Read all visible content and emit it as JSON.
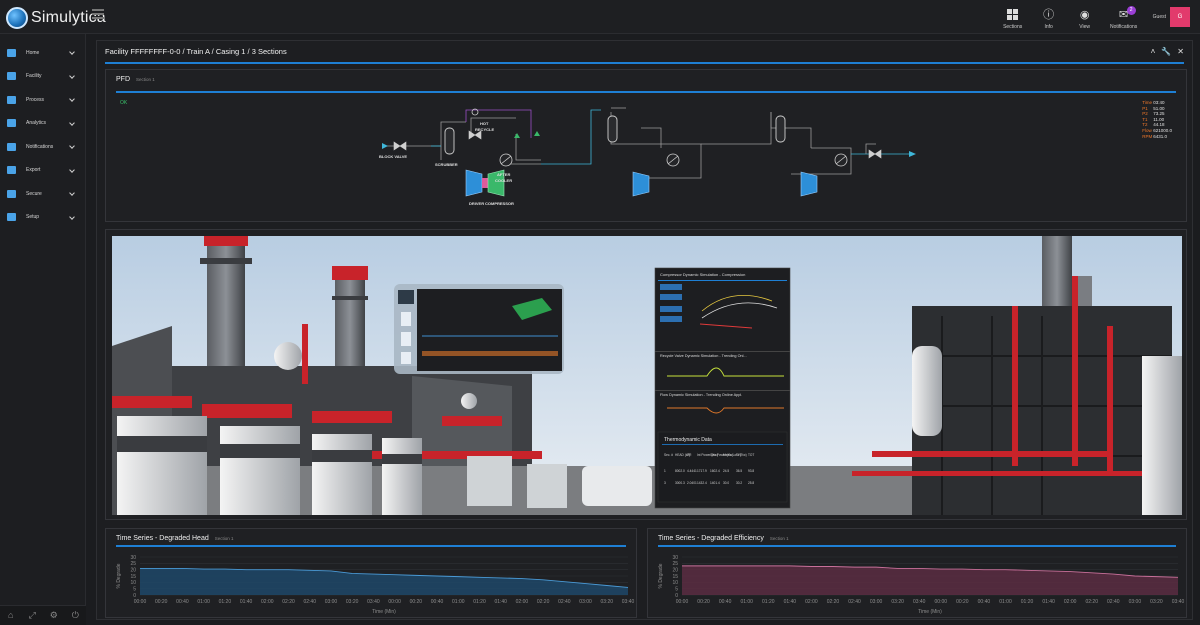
{
  "app": {
    "name": "Simulytica"
  },
  "topbar": {
    "actions": [
      {
        "id": "sections",
        "label": "Sections"
      },
      {
        "id": "info",
        "label": "Info"
      },
      {
        "id": "view",
        "label": "View"
      },
      {
        "id": "notifications",
        "label": "Notifications",
        "badge": "2"
      }
    ],
    "user": {
      "name": "Guest",
      "initial": "G"
    }
  },
  "sidebar": {
    "items": [
      {
        "label": "Home",
        "icon": "home-icon"
      },
      {
        "label": "Facility",
        "icon": "facility-icon"
      },
      {
        "label": "Process",
        "icon": "process-icon"
      },
      {
        "label": "Analytics",
        "icon": "analytics-icon"
      },
      {
        "label": "Notifications",
        "icon": "envelope-icon"
      },
      {
        "label": "Export",
        "icon": "export-icon"
      },
      {
        "label": "Secure",
        "icon": "lock-icon"
      },
      {
        "label": "Setup",
        "icon": "gear-icon"
      }
    ]
  },
  "facility": {
    "title": "Facility FFFFFFFF-0-0 / Train A / Casing 1 / 3 Sections"
  },
  "pfd": {
    "title": "PFD",
    "section": "Section 1",
    "status": "OK",
    "labels": {
      "block_valve": "BLOCK VALVE",
      "scrubber": "SCRUBBER",
      "hot_recycle_1": "HOT",
      "hot_recycle_2": "RECYCLE",
      "after_cooler_1": "AFTER",
      "after_cooler_2": "COOLER",
      "driver": "DRIVER",
      "compressor": "COMPRESSOR"
    },
    "readout": [
      {
        "k": "Time",
        "v": "03:40"
      },
      {
        "k": "P1",
        "v": "51.00"
      },
      {
        "k": "P2",
        "v": "73.25"
      },
      {
        "k": "T1",
        "v": "11.00"
      },
      {
        "k": "T2",
        "v": "44.18"
      },
      {
        "k": "Flow",
        "v": "621000.0"
      },
      {
        "k": "RPM",
        "v": "6431.0"
      }
    ]
  },
  "scene": {
    "popup_panels": [
      {
        "title": "Compressor Dynamic Simulation - Compression"
      },
      {
        "title": "Recycle Valve Dynamic Simulation - Trending Onl..."
      },
      {
        "title": "Flow Dynamic Simulation - Trending Online Appl."
      }
    ],
    "thermo": {
      "title": "Thermodynamic Data",
      "headers": [
        "Sec. #",
        "HEAD (kJ)",
        "PR",
        "Int Power (Kw)",
        "Gas Power (Kw)",
        "Mech. Loss (Kw)",
        "T?T",
        "TOT"
      ],
      "rows": [
        [
          "1",
          "8002.0",
          "4.4441",
          "1717.9",
          "1602.4",
          "24.5",
          "36.5",
          "93.8"
        ],
        [
          "3",
          "3000.3",
          "2.0401",
          "1432.4",
          "1401.4",
          "30.0",
          "30.2",
          "25.8"
        ]
      ]
    }
  },
  "chart_data": [
    {
      "type": "area",
      "title": "Time Series - Degraded Head",
      "section": "Section 1",
      "xlabel": "Time (Min)",
      "ylabel": "% Degrade",
      "ylim": [
        0,
        30
      ],
      "yticks": [
        0,
        5,
        10,
        15,
        20,
        25,
        30
      ],
      "x": [
        "00:00",
        "00:20",
        "00:40",
        "01:00",
        "01:20",
        "01:40",
        "02:00",
        "02:20",
        "02:40",
        "03:00",
        "03:20",
        "03:40",
        "00:00",
        "00:20",
        "00:40",
        "01:00",
        "01:20",
        "01:40",
        "02:00",
        "02:20",
        "02:40",
        "03:00",
        "03:20",
        "03:40"
      ],
      "values": [
        21,
        21,
        21,
        20.5,
        20.5,
        20,
        20,
        20,
        19.5,
        19,
        17,
        16.5,
        16,
        15.5,
        15,
        14.5,
        14,
        13.5,
        13,
        12,
        10.5,
        9,
        7.5,
        6
      ],
      "color": "#4a9ad6",
      "fill": "#1f4868"
    },
    {
      "type": "area",
      "title": "Time Series - Degraded Efficiency",
      "section": "Section 1",
      "xlabel": "Time (Min)",
      "ylabel": "% Degrade",
      "ylim": [
        0,
        30
      ],
      "yticks": [
        0,
        5,
        10,
        15,
        20,
        25,
        30
      ],
      "x": [
        "00:00",
        "00:20",
        "00:40",
        "01:00",
        "01:20",
        "01:40",
        "02:00",
        "02:20",
        "02:40",
        "03:00",
        "03:20",
        "03:40",
        "00:00",
        "00:20",
        "00:40",
        "01:00",
        "01:20",
        "01:40",
        "02:00",
        "02:20",
        "02:40",
        "03:00",
        "03:20",
        "03:40"
      ],
      "values": [
        23,
        23,
        23,
        23,
        23,
        23,
        22.5,
        22.5,
        22,
        22,
        21,
        21,
        20.5,
        20.5,
        20,
        20,
        19.5,
        19,
        18.5,
        17.5,
        16.5,
        15,
        14.5,
        14
      ],
      "color": "#c8709a",
      "fill": "#5a2d42"
    }
  ]
}
